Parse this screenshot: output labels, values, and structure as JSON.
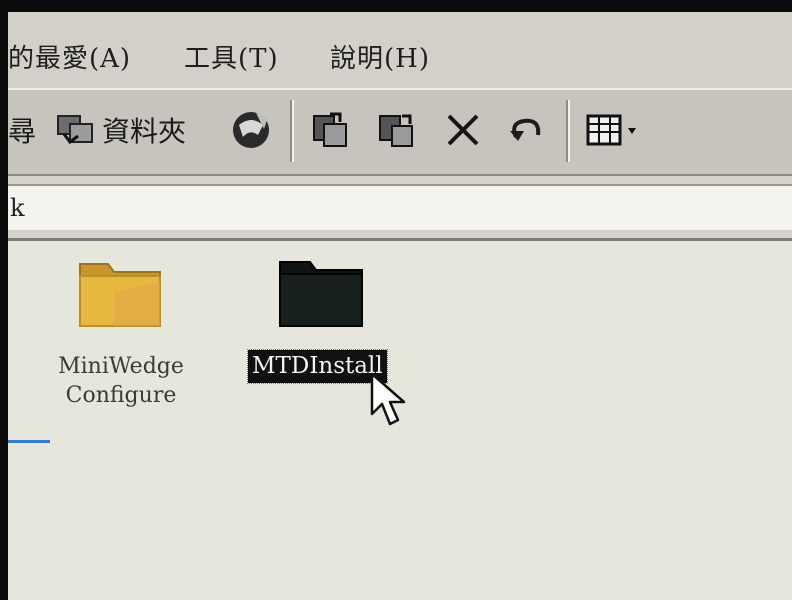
{
  "menubar": {
    "items": [
      {
        "label": "的最愛(A)"
      },
      {
        "label": "工具(T)"
      },
      {
        "label": "說明(H)"
      }
    ]
  },
  "toolbar": {
    "partial_label": "尋",
    "folders_label": "資料夾",
    "icons": [
      "folders-icon",
      "history-icon",
      "move-to-icon",
      "copy-to-icon",
      "delete-icon",
      "undo-icon",
      "views-icon"
    ]
  },
  "address": {
    "value": "k"
  },
  "folders": [
    {
      "name": "MiniWedge Configure",
      "line1": "MiniWedge",
      "line2": "Configure",
      "selected": false
    },
    {
      "name": "MTDInstall",
      "line1": "MTDInstall",
      "selected": true
    }
  ],
  "colors": {
    "folder_yellow": "#e6b840",
    "selected_bg": "#111111",
    "accent_line": "#3a78c8"
  }
}
